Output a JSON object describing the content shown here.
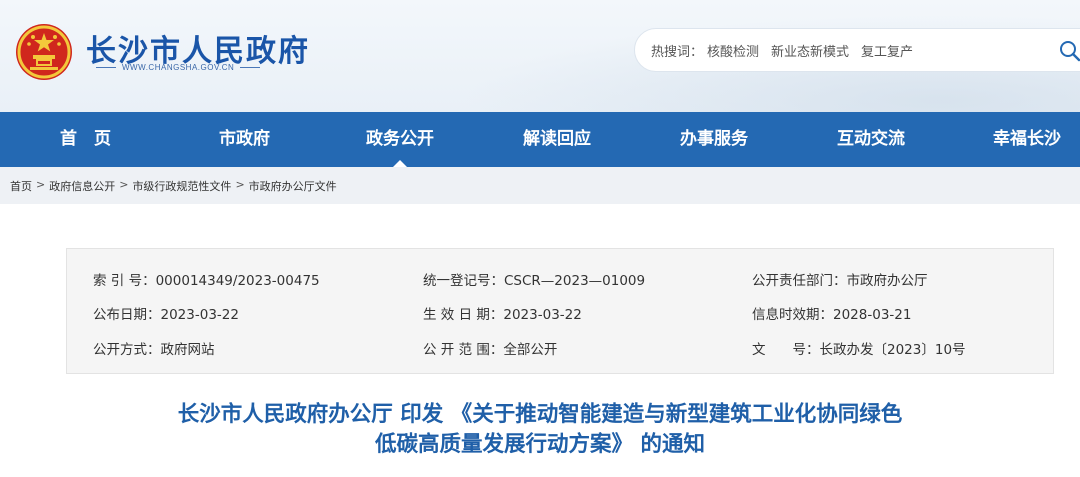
{
  "header": {
    "site_title": "长沙市人民政府",
    "site_domain": "WWW.CHANGSHA.GOV.CN",
    "search": {
      "hot_label": "热搜词：",
      "hot_terms": [
        "核酸检测",
        "新业态新模式",
        "复工复产"
      ]
    }
  },
  "nav": {
    "items": [
      "首　页",
      "市政府",
      "政务公开",
      "解读回应",
      "办事服务",
      "互动交流",
      "幸福长沙"
    ],
    "active_index": 2
  },
  "breadcrumb": [
    "首页",
    "政府信息公开",
    "市级行政规范性文件",
    "市政府办公厅文件"
  ],
  "breadcrumb_sep": ">",
  "info": {
    "index_no": {
      "label": "索 引 号：",
      "value": "000014349/2023-00475"
    },
    "reg_no": {
      "label": "统一登记号：",
      "value": "CSCR—2023—01009"
    },
    "dept": {
      "label": "公开责任部门：",
      "value": "市政府办公厅"
    },
    "pub_date": {
      "label": "公布日期：",
      "value": "2023-03-22"
    },
    "eff_date": {
      "label": "生 效 日 期：",
      "value": "2023-03-22"
    },
    "valid_until": {
      "label": "信息时效期：",
      "value": "2028-03-21"
    },
    "pub_method": {
      "label": "公开方式：",
      "value": "政府网站"
    },
    "pub_scope": {
      "label": "公 开 范 围：",
      "value": "全部公开"
    },
    "doc_no": {
      "label": "文　　号：",
      "value": "长政办发〔2023〕10号"
    }
  },
  "document": {
    "title_line1": "长沙市人民政府办公厅 印发 《关于推动智能建造与新型建筑工业化协同绿色",
    "title_line2": "低碳高质量发展行动方案》 的通知"
  },
  "colors": {
    "brand_blue": "#2469b3",
    "title_blue": "#1f5fa8",
    "emblem_red": "#d0271d",
    "emblem_gold": "#f3c83b"
  }
}
